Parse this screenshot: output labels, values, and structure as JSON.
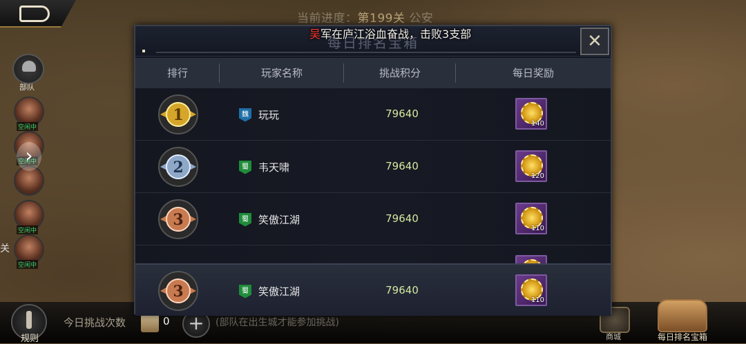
{
  "header": {
    "progress_prefix": "当前进度：",
    "progress_stage": "第199关",
    "progress_place": "公安"
  },
  "marquee": {
    "faction": "吴",
    "message": "军在庐江浴血奋战，击败3支部"
  },
  "sidebar": {
    "troop_label": "部队",
    "idle_tag": "空闲中",
    "pass_label": "关"
  },
  "modal": {
    "title": "每日排名宝箱",
    "columns": [
      "排行",
      "玩家名称",
      "挑战积分",
      "每日奖励"
    ],
    "rows": [
      {
        "rank": 1,
        "faction": "魏",
        "name": "玩玩",
        "score": "79640",
        "reward_qty": "140"
      },
      {
        "rank": 2,
        "faction": "蜀",
        "name": "韦天啸",
        "score": "79640",
        "reward_qty": "120"
      },
      {
        "rank": 3,
        "faction": "蜀",
        "name": "笑傲江湖",
        "score": "79640",
        "reward_qty": "110"
      }
    ],
    "my_row": {
      "rank": 3,
      "faction": "蜀",
      "name": "笑傲江湖",
      "score": "79640",
      "reward_qty": "110"
    }
  },
  "bottom": {
    "rules_label": "规则",
    "challenge_label": "今日挑战次数",
    "challenge_count": "0",
    "challenge_note": "(部队在出生城才能参加挑战)",
    "shop_label": "商城",
    "chest_label": "每日排名宝箱"
  },
  "colors": {
    "gold": "#d6a62a",
    "silver": "#8fa8c8",
    "bronze": "#c87a50",
    "score": "#d5e8a0",
    "wei": "#1e6fa8",
    "shu": "#1f8c3a"
  }
}
